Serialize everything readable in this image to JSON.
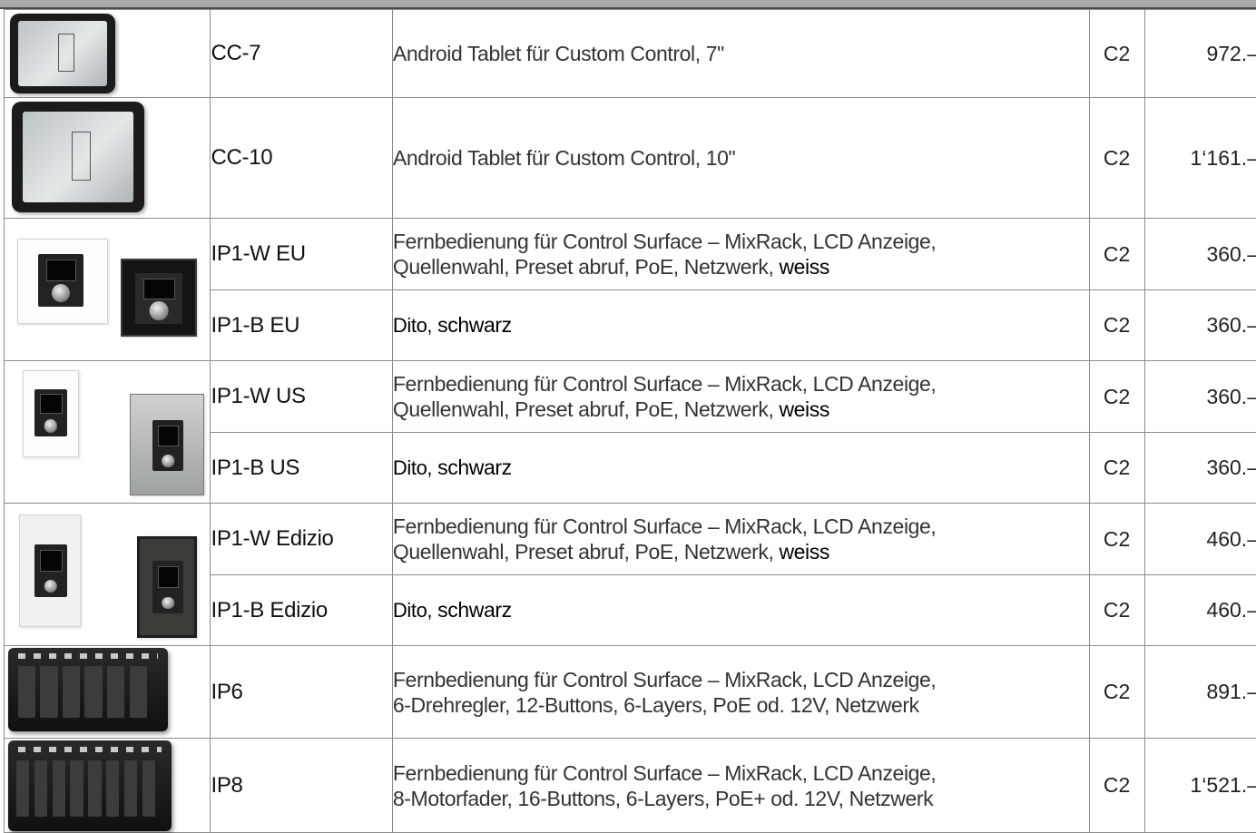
{
  "rows": [
    {
      "code": "CC-7",
      "desc": "Android Tablet für Custom Control, 7\"",
      "cat": "C2",
      "price": "972.–"
    },
    {
      "code": "CC-10",
      "desc": "Android Tablet für Custom Control, 10\"",
      "cat": "C2",
      "price": "1‘161.–"
    },
    {
      "code": "IP1-W EU",
      "desc_line1": "Fernbedienung für Control Surface – MixRack, LCD Anzeige,",
      "desc_line2": "Quellenwahl, Preset abruf, PoE, Netzwerk,",
      "desc_emph": "weiss",
      "cat": "C2",
      "price": "360.–"
    },
    {
      "code": "IP1-B EU",
      "desc_dito": "Dito,",
      "desc_emph": "schwarz",
      "cat": "C2",
      "price": "360.–"
    },
    {
      "code": "IP1-W US",
      "desc_line1": "Fernbedienung für Control Surface – MixRack, LCD Anzeige,",
      "desc_line2": "Quellenwahl, Preset abruf, PoE, Netzwerk,",
      "desc_emph": "weiss",
      "cat": "C2",
      "price": "360.–"
    },
    {
      "code": "IP1-B US",
      "desc_dito": "Dito,",
      "desc_emph": "schwarz",
      "cat": "C2",
      "price": "360.–"
    },
    {
      "code": "IP1-W Edizio",
      "desc_line1": "Fernbedienung für Control Surface – MixRack, LCD Anzeige,",
      "desc_line2": "Quellenwahl, Preset abruf, PoE, Netzwerk,",
      "desc_emph": "weiss",
      "cat": "C2",
      "price": "460.–"
    },
    {
      "code": "IP1-B Edizio",
      "desc_dito": "Dito,",
      "desc_emph": "schwarz",
      "cat": "C2",
      "price": "460.–"
    },
    {
      "code": "IP6",
      "desc_line1": "Fernbedienung für Control Surface – MixRack, LCD Anzeige,",
      "desc_line2": "6-Drehregler, 12-Buttons, 6-Layers, PoE od. 12V, Netzwerk",
      "cat": "C2",
      "price": "891.–"
    },
    {
      "code": "IP8",
      "desc_line1": "Fernbedienung für Control Surface – MixRack, LCD Anzeige,",
      "desc_line2": "8-Motorfader, 16-Buttons, 6-Layers, PoE+ od. 12V, Netzwerk",
      "cat": "C2",
      "price": "1‘521.–"
    }
  ]
}
